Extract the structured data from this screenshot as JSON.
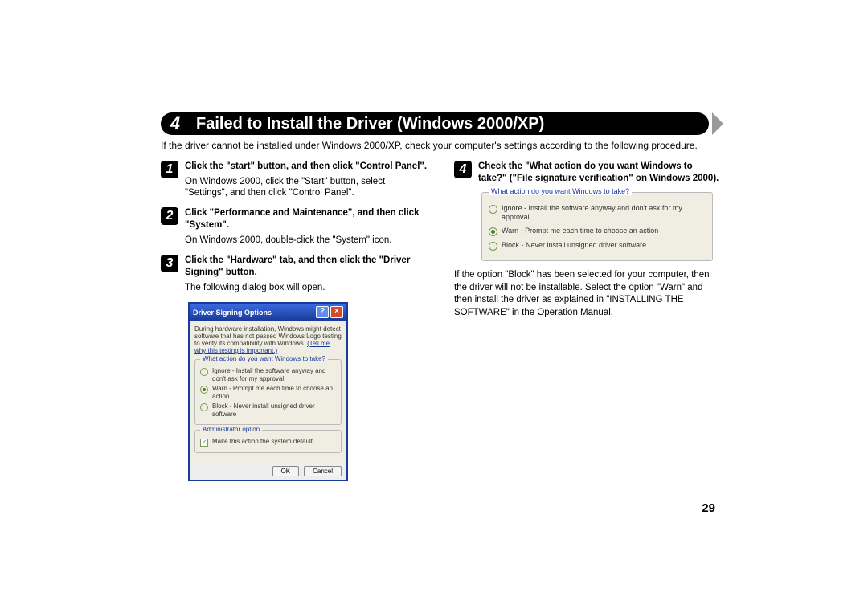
{
  "section": {
    "number": "4",
    "title": "Failed to Install the Driver (Windows 2000/XP)"
  },
  "intro": "If the driver cannot be installed under Windows 2000/XP, check your computer's settings according to the following procedure.",
  "steps": {
    "s1": {
      "num": "1",
      "title": "Click the \"start\" button, and then click \"Control Panel\".",
      "desc": "On Windows 2000, click the \"Start\" button, select \"Settings\", and then click \"Control Panel\"."
    },
    "s2": {
      "num": "2",
      "title": "Click \"Performance and Maintenance\", and then click \"System\".",
      "desc": "On Windows 2000, double-click the \"System\" icon."
    },
    "s3": {
      "num": "3",
      "title": "Click the \"Hardware\" tab, and then click the \"Driver Signing\" button.",
      "desc": "The following dialog box will open."
    },
    "s4": {
      "num": "4",
      "title": "Check the \"What action do you want Windows to take?\" (\"File signature verification\" on Windows 2000).",
      "desc": ""
    }
  },
  "dialog": {
    "title": "Driver Signing Options",
    "intro1": "During hardware installation, Windows might detect software that has not passed Windows Logo testing to verify its compatibility with Windows.",
    "intro_link": "(Tell me why this testing is important.)",
    "group1_legend": "What action do you want Windows to take?",
    "opt_ignore": "Ignore - Install the software anyway and don't ask for my approval",
    "opt_warn": "Warn - Prompt me each time to choose an action",
    "opt_block": "Block - Never install unsigned driver software",
    "group2_legend": "Administrator option",
    "opt_admin": "Make this action the system default",
    "ok": "OK",
    "cancel": "Cancel"
  },
  "panel2": {
    "legend": "What action do you want Windows to take?",
    "opt_ignore": "Ignore - Install the software anyway and don't ask for my approval",
    "opt_warn": "Warn - Prompt me each time to choose an action",
    "opt_block": "Block - Never install unsigned driver software"
  },
  "note_after": "If the option \"Block\" has been selected for your computer, then the driver will not be installable. Select the option \"Warn\" and then install the driver as explained in \"INSTALLING THE SOFTWARE\" in the Operation Manual.",
  "page_number": "29"
}
